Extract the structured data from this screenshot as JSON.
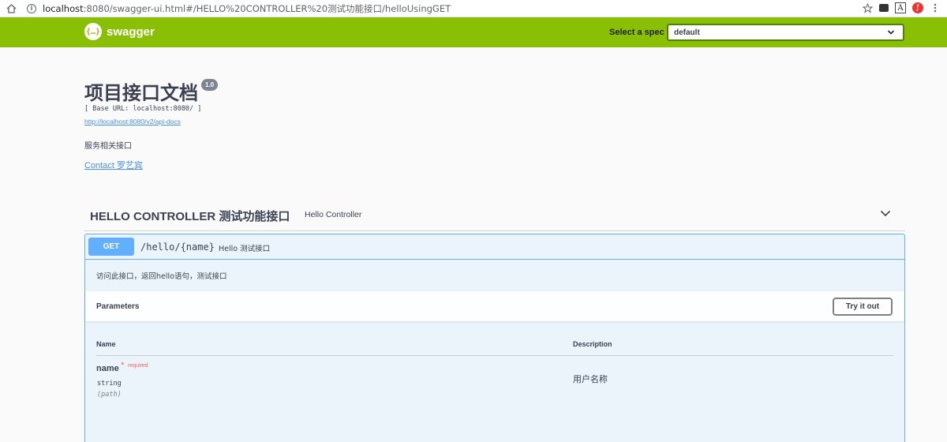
{
  "browser": {
    "url_host": "localhost",
    "url_rest": ":8080/swagger-ui.html#/HELLO%20CONTROLLER%20测试功能接口/helloUsingGET"
  },
  "topbar": {
    "logo_symbol": "{…}",
    "logo_text": "swagger",
    "select_label": "Select a spec",
    "select_value": "default"
  },
  "info": {
    "title": "项目接口文档",
    "version": "1.0",
    "base_url": "[ Base URL: localhost:8080/ ]",
    "api_docs_link": "http://localhost:8080/v2/api-docs",
    "description": "服务相关接口",
    "contact": "Contact 罗艺宾"
  },
  "tag": {
    "name": "HELLO CONTROLLER 测试功能接口",
    "description": "Hello Controller"
  },
  "operation": {
    "method": "GET",
    "path": "/hello/{name}",
    "summary": "Hello 测试接口",
    "description": "访问此接口，返回hello语句，测试接口",
    "parameters_title": "Parameters",
    "try_button": "Try it out",
    "columns": {
      "name": "Name",
      "description": "Description"
    },
    "params": [
      {
        "name": "name",
        "required_star": "*",
        "required_label": "required",
        "type": "string",
        "in": "(path)",
        "description": "用户名称"
      }
    ]
  },
  "colors": {
    "topbar": "#89bf04",
    "get": "#61affe",
    "required": "#ff6060",
    "link": "#4990e2"
  }
}
